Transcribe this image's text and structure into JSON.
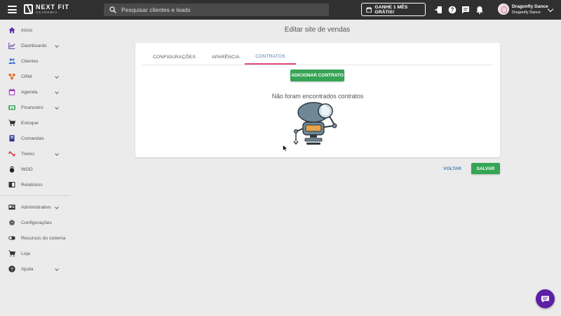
{
  "header": {
    "logo_name": "NEXT FIT",
    "logo_sub": "ACADEMIA",
    "search_placeholder": "Pesquisar clientes e leads",
    "promo_label": "GANHE 1 MÊS GRÁTIS!",
    "user_name": "Dragonfly Dance",
    "user_org": "Dragonfly Dance"
  },
  "sidebar": {
    "items": [
      {
        "label": "Início",
        "icon": "home-icon",
        "color": "#5b2fa3"
      },
      {
        "label": "Dashboards",
        "icon": "chart-icon",
        "color": "#5b2fa3"
      },
      {
        "label": "Clientes",
        "icon": "people-icon",
        "color": "#3b6fd1"
      },
      {
        "label": "CRM",
        "icon": "crm-icon",
        "color": "#e86a2c"
      },
      {
        "label": "Agenda",
        "icon": "calendar-icon",
        "color": "#9c27b0"
      },
      {
        "label": "Financeiro",
        "icon": "money-icon",
        "color": "#2e9e4f"
      },
      {
        "label": "Estoque",
        "icon": "cart-icon",
        "color": "#333333"
      },
      {
        "label": "Comandas",
        "icon": "notebook-icon",
        "color": "#2c3a8c"
      },
      {
        "label": "Treino",
        "icon": "dumbbell-icon",
        "color": "#e0313a"
      },
      {
        "label": "WOD",
        "icon": "kettlebell-icon",
        "color": "#222222"
      },
      {
        "label": "Relatórios",
        "icon": "report-icon",
        "color": "#333333"
      },
      {
        "label": "Administrativo",
        "icon": "id-card-icon",
        "color": "#333333"
      },
      {
        "label": "Configurações",
        "icon": "gear-icon",
        "color": "#333333"
      },
      {
        "label": "Recursos do sistema",
        "icon": "toggle-icon",
        "color": "#333333"
      },
      {
        "label": "Loja",
        "icon": "shop-cart-icon",
        "color": "#333333"
      },
      {
        "label": "Ajuda",
        "icon": "help-icon",
        "color": "#333333"
      }
    ]
  },
  "main": {
    "title": "Editar site de vendas",
    "tabs": [
      {
        "label": "CONFIGURAÇÕES",
        "active": false
      },
      {
        "label": "APARÊNCIA",
        "active": false
      },
      {
        "label": "CONTRATOS",
        "active": true
      }
    ],
    "add_button": "ADICIONAR CONTRATO",
    "empty_message": "Não foram encontrados contratos",
    "back_button": "VOLTAR",
    "save_button": "SALVAR"
  },
  "colors": {
    "topbar": "#303030",
    "accent_green": "#36a455",
    "tab_active_text": "#4a7ab5",
    "tab_active_underline": "#e5487a",
    "chat_button": "#5b1fa3"
  }
}
